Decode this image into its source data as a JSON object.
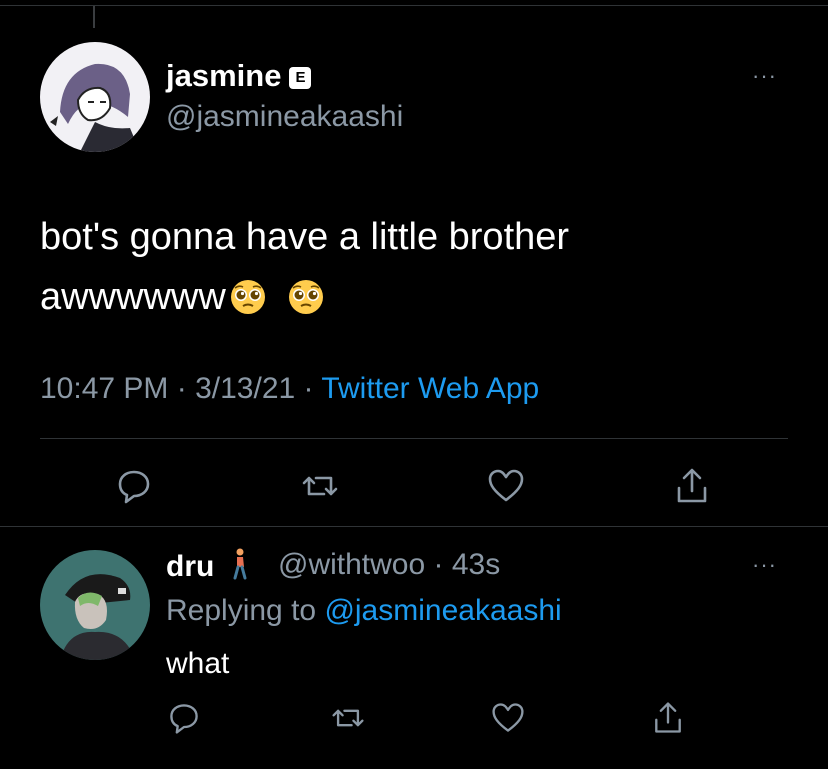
{
  "tweet": {
    "author_name": "jasmine",
    "author_badge": "E",
    "author_handle": "@jasmineakaashi",
    "text_line1": "bot's gonna have a little brother",
    "text_line2": "awwwwww",
    "emoji": [
      "pleading-face",
      "pleading-face"
    ],
    "time": "10:47 PM",
    "date": "3/13/21",
    "source": "Twitter Web App",
    "more_label": "···"
  },
  "reply": {
    "author_name": "dru",
    "author_emoji": "person-walking",
    "author_handle": "@withtwoo",
    "age": "43s",
    "replying_prefix": "Replying to ",
    "replying_to": "@jasmineakaashi",
    "text": "what",
    "more_label": "···"
  },
  "icons": {
    "reply": "reply-icon",
    "retweet": "retweet-icon",
    "like": "heart-icon",
    "share": "share-icon"
  },
  "colors": {
    "background": "#000000",
    "link": "#1d9bf0",
    "muted": "#8b98a5",
    "divider": "#2f3336"
  }
}
